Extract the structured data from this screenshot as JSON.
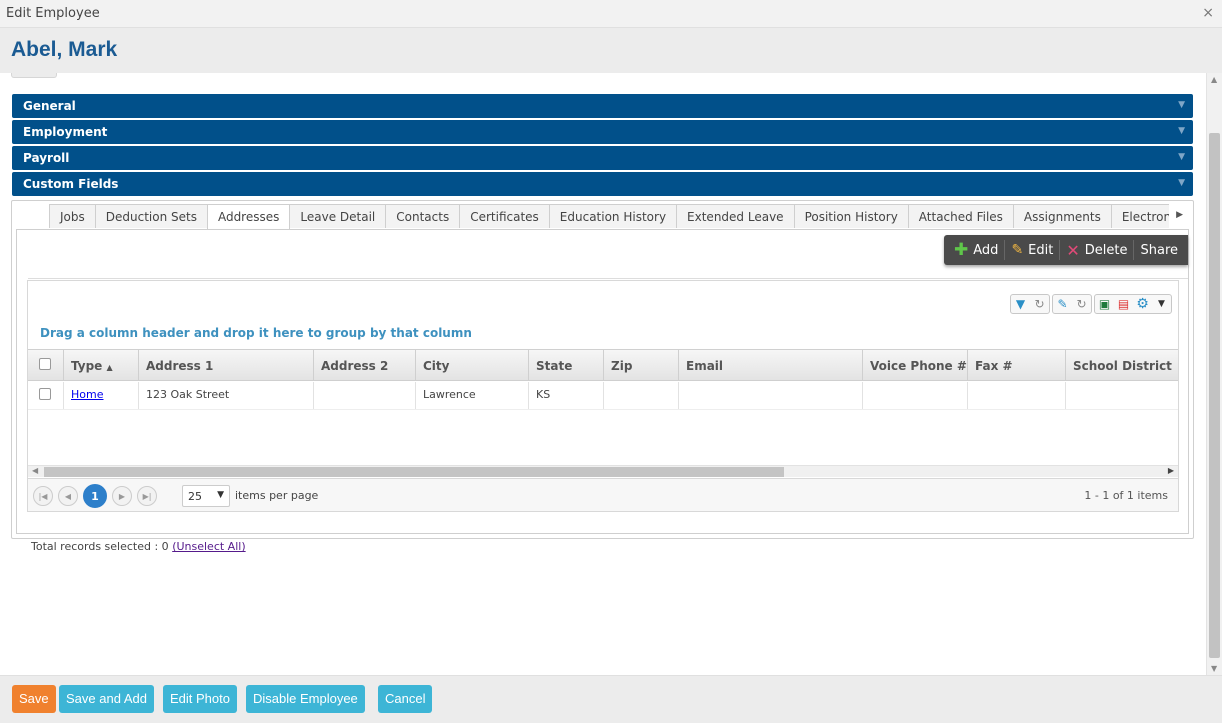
{
  "window": {
    "title": "Edit Employee",
    "close_glyph": "×"
  },
  "employee": {
    "name": "Abel, Mark"
  },
  "accordion": [
    "General",
    "Employment",
    "Payroll",
    "Custom Fields"
  ],
  "tabs": [
    "Jobs",
    "Deduction Sets",
    "Addresses",
    "Leave Detail",
    "Contacts",
    "Certificates",
    "Education History",
    "Extended Leave",
    "Position History",
    "Attached Files",
    "Assignments",
    "Electronic Del"
  ],
  "active_tab": "Addresses",
  "actions": {
    "add": "Add",
    "edit": "Edit",
    "delete": "Delete",
    "share": "Share"
  },
  "grid": {
    "group_hint": "Drag a column header and drop it here to group by that column",
    "columns": [
      "Type",
      "Address 1",
      "Address 2",
      "City",
      "State",
      "Zip",
      "Email",
      "Voice Phone #",
      "Fax #",
      "School District"
    ],
    "sort_indicator": "▲",
    "rows": [
      {
        "type": "Home",
        "address1": "123 Oak Street",
        "address2": "",
        "city": "Lawrence",
        "state": "KS",
        "zip": "",
        "email": "",
        "voice": "",
        "fax": "",
        "district": ""
      }
    ]
  },
  "pager": {
    "current": "1",
    "page_size": "25",
    "items_per_page_label": "items per page",
    "info": "1 - 1 of 1 items"
  },
  "selection": {
    "text": "Total records selected : 0",
    "unselect": "(Unselect All)"
  },
  "footer": {
    "save": "Save",
    "save_add": "Save and Add",
    "edit_photo": "Edit Photo",
    "disable": "Disable Employee",
    "cancel": "Cancel"
  },
  "colors": {
    "brand_blue": "#01508a",
    "name_blue": "#1b5b93",
    "button_teal": "#3db5d6",
    "button_orange": "#f0812e"
  },
  "icons": [
    "close-icon",
    "chevron-down-icon",
    "plus-icon",
    "pencil-icon",
    "delete-x-icon",
    "filter-icon",
    "refresh-icon",
    "wrench-icon",
    "excel-icon",
    "pdf-icon",
    "gear-icon",
    "first-page-icon",
    "prev-page-icon",
    "next-page-icon",
    "last-page-icon"
  ]
}
